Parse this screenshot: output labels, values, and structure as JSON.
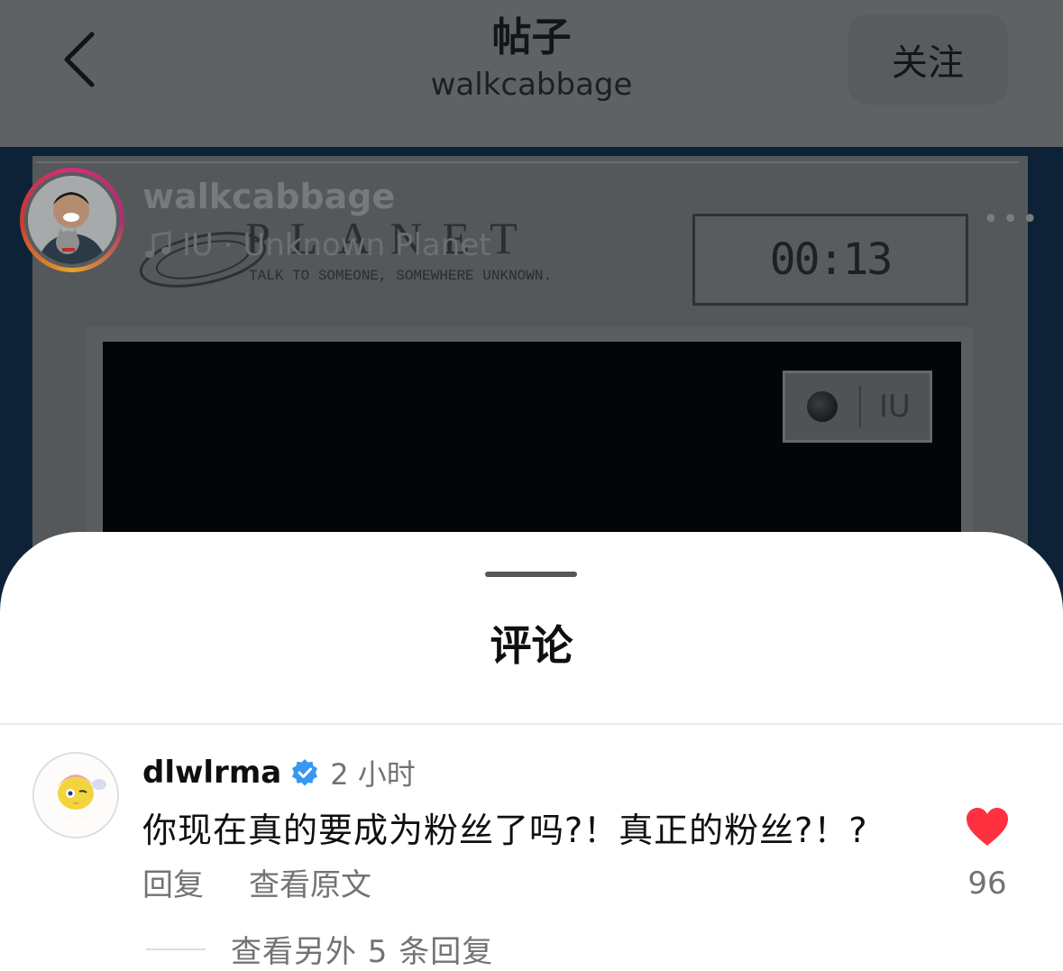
{
  "header": {
    "title": "帖子",
    "subtitle": "walkcabbage",
    "follow_label": "关注"
  },
  "post": {
    "username": "walkcabbage",
    "music": "IU · Unknown Planet",
    "planet_word": "PLANET",
    "tagline": "TALK TO SOMEONE, SOMEWHERE UNKNOWN.",
    "timer": "00:13",
    "badge_text": "IU"
  },
  "comments_sheet": {
    "title": "评论",
    "comment": {
      "username": "dlwlrma",
      "time": "2 小时",
      "text": "你现在真的要成为粉丝了吗?！真正的粉丝?！?",
      "reply_label": "回复",
      "translate_label": "查看原文",
      "likes": "96",
      "view_replies": "查看另外 5 条回复"
    }
  },
  "colors": {
    "verified": "#3897f0",
    "heart": "#ff3040",
    "overlay": "#5f6264"
  }
}
